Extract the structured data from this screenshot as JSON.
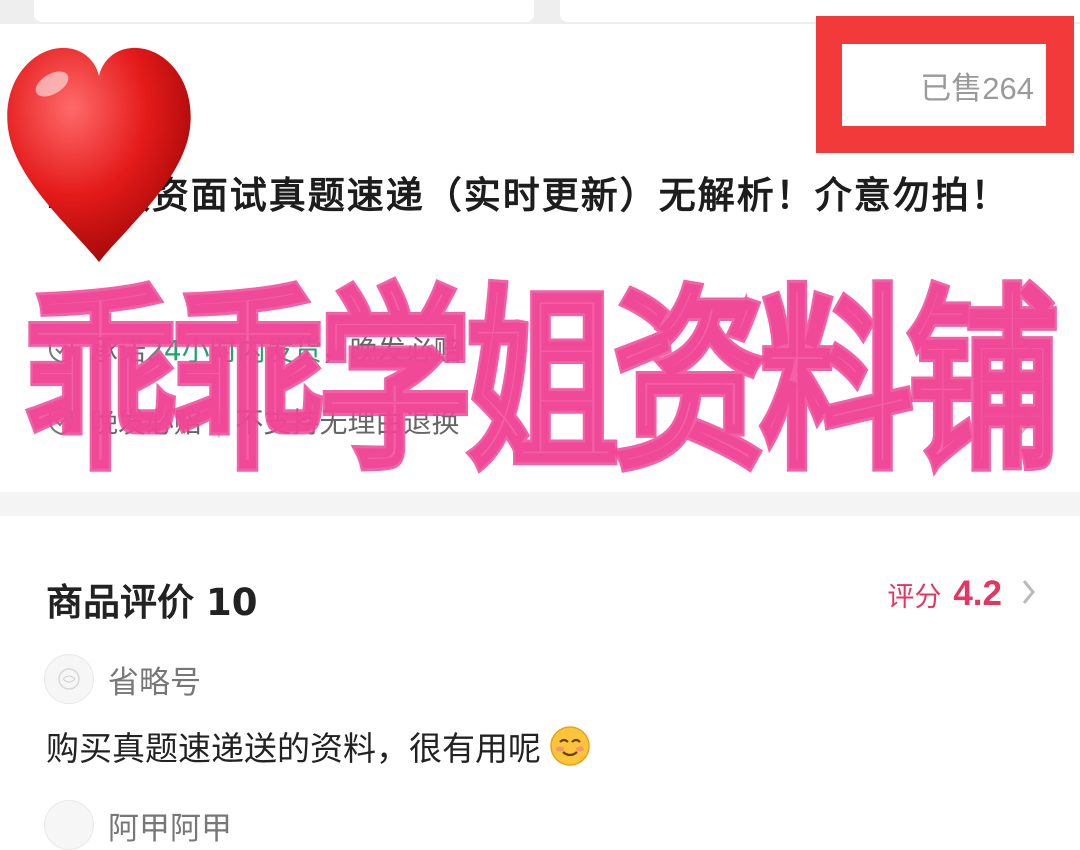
{
  "product": {
    "sold_label": "已售264",
    "title": "2…教资面试真题速递（实时更新）无解析！介意勿拍！"
  },
  "promises": [
    {
      "prefix": "承诺",
      "highlight": "24小时内发货",
      "suffix": "，晚发必赔"
    },
    {
      "prefix": "晚发必赔",
      "separator": "|",
      "suffix": "不支持无理由退换"
    }
  ],
  "reviews": {
    "header_label": "商品评价",
    "count": "10",
    "rating_label": "评分",
    "rating_value": "4.2",
    "items": [
      {
        "user": "省略号",
        "text": "购买真题速递送的资料，很有用呢"
      },
      {
        "user": "阿甲阿甲",
        "text": ""
      }
    ]
  },
  "overlay": {
    "watermark_text": "乖乖学姐资料铺"
  },
  "colors": {
    "frame_red": "#f23a3a",
    "rating_pink": "#e53560",
    "promise_green": "#1fa46a",
    "watermark_pink": "#f046a0"
  },
  "icons": {
    "promise_icon": "shield-check-icon",
    "chevron": "chevron-right-icon",
    "decoration": "heart-icon",
    "emoji": "smiling-face-emoji"
  }
}
